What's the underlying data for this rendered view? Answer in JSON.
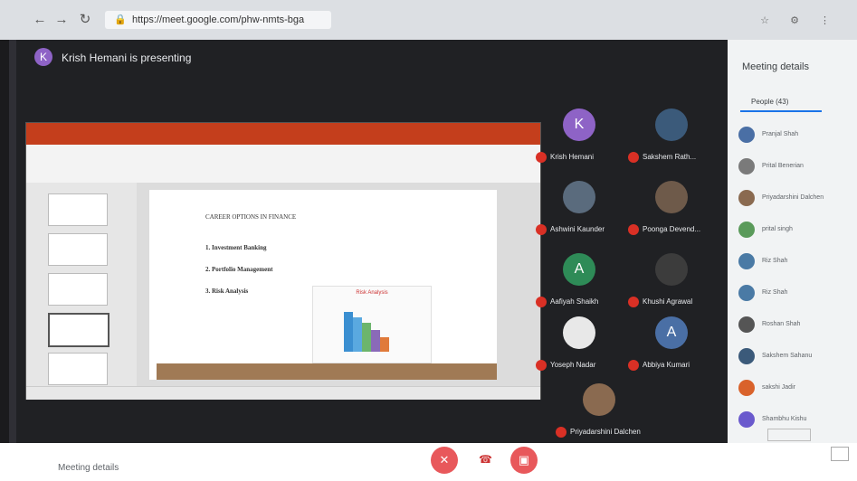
{
  "browser": {
    "url": "https://meet.google.com/phw-nmts-bga",
    "back_icon": "arrow-left-icon",
    "forward_icon": "arrow-right-icon",
    "reload_icon": "reload-icon"
  },
  "presenter": {
    "initial": "K",
    "text": "Krish Hemani is presenting"
  },
  "slide": {
    "heading": "CAREER OPTIONS IN FINANCE",
    "bullets": [
      "1.  Investment Banking",
      "2.  Portfolio Management",
      "3.  Risk Analysis"
    ],
    "chart_title": "Risk Analysis"
  },
  "tiles": [
    {
      "initial": "K",
      "name": "Krish Hemani",
      "color": "#8e63c6"
    },
    {
      "initial": "",
      "name": "Sakshem Rath...",
      "color": "#3b5a7a"
    },
    {
      "initial": "",
      "name": "Ashwini Kaunder",
      "color": "#5a6b7d"
    },
    {
      "initial": "",
      "name": "Poonga Devend...",
      "color": "#6e5a4a"
    },
    {
      "initial": "A",
      "name": "Aafiyah Shaikh",
      "color": "#2e8b57"
    },
    {
      "initial": "",
      "name": "Khushi Agrawal",
      "color": "#3c3c3c"
    },
    {
      "initial": "",
      "name": "Yoseph Nadar",
      "color": "#e8e8e8"
    },
    {
      "initial": "A",
      "name": "Abbiya Kumari",
      "color": "#4a6fa5"
    },
    {
      "initial": "",
      "name": "Priyadarshini Dalchen",
      "color": "#8a6a50"
    }
  ],
  "sidebar": {
    "title": "Meeting details",
    "people_tab": "People (43)",
    "people": [
      {
        "name": "Pranjal Shah",
        "color": "#4a6fa5"
      },
      {
        "name": "Prital Benerian",
        "color": "#7a7a7a"
      },
      {
        "name": "Priyadarshini Dalchen",
        "color": "#8a6a50"
      },
      {
        "name": "prital singh",
        "color": "#5a9a5a"
      },
      {
        "name": "Riz Shah",
        "color": "#4a7aa5"
      },
      {
        "name": "Riz Shah",
        "color": "#4a7aa5"
      },
      {
        "name": "Roshan Shah",
        "color": "#555555"
      },
      {
        "name": "Sakshem Sahanu",
        "color": "#3b5a7a"
      },
      {
        "name": "sakshi Jadir",
        "color": "#d9622b"
      },
      {
        "name": "Shambhu Kishu",
        "color": "#6a5acd"
      }
    ]
  },
  "bottom": {
    "label": "Meeting details",
    "end_icon": "phone-hangup-icon",
    "present_icon": "present-icon"
  }
}
